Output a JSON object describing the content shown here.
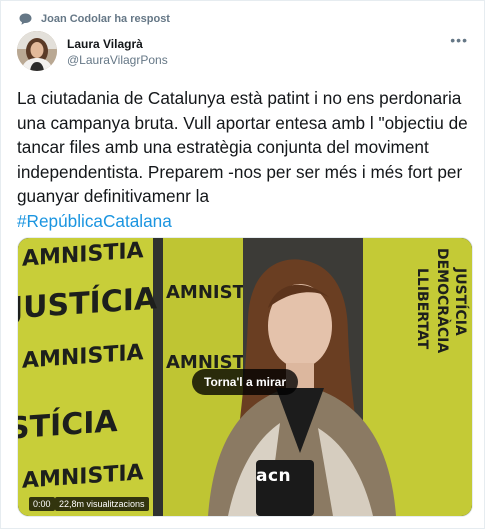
{
  "reply_context": {
    "text": "Joan Codolar ha respost",
    "icon": "reply-speech-bubble-icon"
  },
  "author": {
    "name": "Laura Vilagrà",
    "handle": "@LauraVilagrPons"
  },
  "more_icon": "more-dots-icon",
  "tweet": {
    "body": "La ciutadania de Catalunya està patint i no ens perdonaria una campanya bruta. Vull aportar entesa amb l \"objectiu de tancar files amb una estratègia conjunta del moviment independentista. Preparem -nos per ser més i més fort per guanyar definitivamenr la",
    "hashtag": "#RepúblicaCatalana"
  },
  "video": {
    "replay_label": "Torna'l a mirar",
    "time": "0:00",
    "views": "22,8m visualitzacions",
    "watermark": "acn",
    "backdrop_texts": [
      "AMNISTIA",
      "JUSTÍCIA",
      "STÍCIA",
      "AMNISTIA"
    ],
    "colors": {
      "poster_yellow": "#d7dc3a",
      "poster_dark": "#1d1f1c"
    }
  },
  "colors": {
    "link": "#1b95e0",
    "muted": "#657786",
    "text": "#14171a",
    "border": "#e6ecf0"
  }
}
